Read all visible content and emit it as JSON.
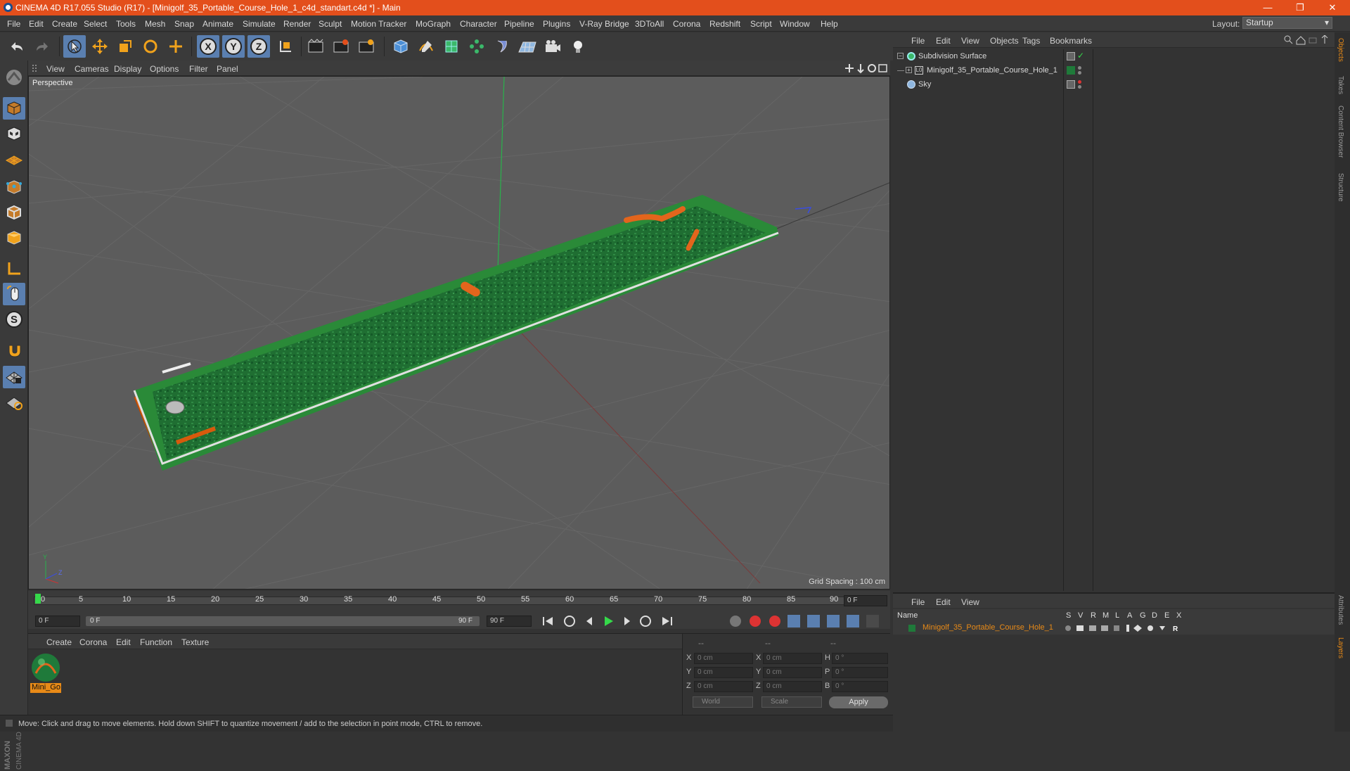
{
  "window": {
    "title": "CINEMA 4D R17.055 Studio (R17) - [Minigolf_35_Portable_Course_Hole_1_c4d_standart.c4d *] - Main",
    "controls": [
      "—",
      "❐",
      "✕"
    ]
  },
  "menubar": {
    "items": [
      "File",
      "Edit",
      "Create",
      "Select",
      "Tools",
      "Mesh",
      "Snap",
      "Animate",
      "Simulate",
      "Render",
      "Sculpt",
      "Motion Tracker",
      "MoGraph",
      "Character",
      "Pipeline",
      "Plugins",
      "V-Ray Bridge",
      "3DToAll",
      "Corona",
      "Redshift",
      "Script",
      "Window",
      "Help"
    ],
    "layout_label": "Layout:",
    "layout_value": "Startup"
  },
  "toolbar": {
    "icons": [
      "undo-icon",
      "redo-icon",
      "live-selection-icon",
      "move-icon",
      "scale-icon",
      "rotate-icon",
      "recent-tools-icon",
      "x-axis-icon",
      "y-axis-icon",
      "z-axis-icon",
      "coordinate-system-icon",
      "render-view-icon",
      "render-picture-viewer-icon",
      "edit-render-settings-icon",
      "cube-primitive-icon",
      "spline-pen-icon",
      "subdivision-surface-icon",
      "array-icon",
      "deformer-icon",
      "floor-icon",
      "camera-icon",
      "light-icon"
    ],
    "axis_labels": [
      "X",
      "Y",
      "Z"
    ]
  },
  "left_toolbar": {
    "icons": [
      "make-editable-icon",
      "model-mode-icon",
      "texture-mode-icon",
      "workplane-mode-icon",
      "points-mode-icon",
      "edges-mode-icon",
      "polygons-mode-icon",
      "axis-mode-icon",
      "tweak-mode-icon",
      "solo-mode-icon",
      "snap-icon",
      "workplane-lock-icon",
      "sculpt-locked-icon"
    ],
    "solo_letter": "S"
  },
  "viewport": {
    "menu": [
      "View",
      "Cameras",
      "Display",
      "Options",
      "Filter",
      "Panel"
    ],
    "label": "Perspective",
    "grid_spacing": "Grid Spacing : 100 cm"
  },
  "timeline": {
    "ticks": [
      "0",
      "5",
      "10",
      "15",
      "20",
      "25",
      "30",
      "35",
      "40",
      "45",
      "50",
      "55",
      "60",
      "65",
      "70",
      "75",
      "80",
      "85",
      "90"
    ],
    "current_frame": "0 F",
    "start_field": "0 F",
    "range_start": "0 F",
    "range_end": "90 F",
    "end_field": "90 F"
  },
  "material_manager": {
    "menu": [
      "Create",
      "Corona",
      "Edit",
      "Function",
      "Texture"
    ],
    "materials": [
      {
        "name": "Mini_Go"
      }
    ]
  },
  "coordinates": {
    "headers": [
      "--",
      "--",
      "--"
    ],
    "rows": [
      {
        "a": "X",
        "av": "0 cm",
        "b": "X",
        "bv": "0 cm",
        "c": "H",
        "cv": "0 °"
      },
      {
        "a": "Y",
        "av": "0 cm",
        "b": "Y",
        "bv": "0 cm",
        "c": "P",
        "cv": "0 °"
      },
      {
        "a": "Z",
        "av": "0 cm",
        "b": "Z",
        "bv": "0 cm",
        "c": "B",
        "cv": "0 °"
      }
    ],
    "world_option": "World",
    "scale_option": "Scale",
    "apply_label": "Apply"
  },
  "status": {
    "text": "Move: Click and drag to move elements. Hold down SHIFT to quantize movement / add to the selection in point mode, CTRL to remove."
  },
  "object_manager": {
    "menu": [
      "File",
      "Edit",
      "View",
      "Objects",
      "Tags",
      "Bookmarks"
    ],
    "objects": [
      {
        "name": "Subdivision Surface"
      },
      {
        "name": "Minigolf_35_Portable_Course_Hole_1"
      },
      {
        "name": "Sky"
      }
    ]
  },
  "layer_manager": {
    "menu": [
      "File",
      "Edit",
      "View"
    ],
    "columns": [
      "Name",
      "S",
      "V",
      "R",
      "M",
      "L",
      "A",
      "G",
      "D",
      "E",
      "X"
    ],
    "layers": [
      {
        "name": "Minigolf_35_Portable_Course_Hole_1",
        "color": "#1f7a3a"
      }
    ]
  },
  "side_tabs": [
    "Objects",
    "Takes",
    "Content Browser",
    "Structure",
    "Attributes",
    "Layers"
  ],
  "colors": {
    "accent": "#e88a17",
    "titlebar": "#e34f1c",
    "selection_blue": "#5a7fb0"
  }
}
